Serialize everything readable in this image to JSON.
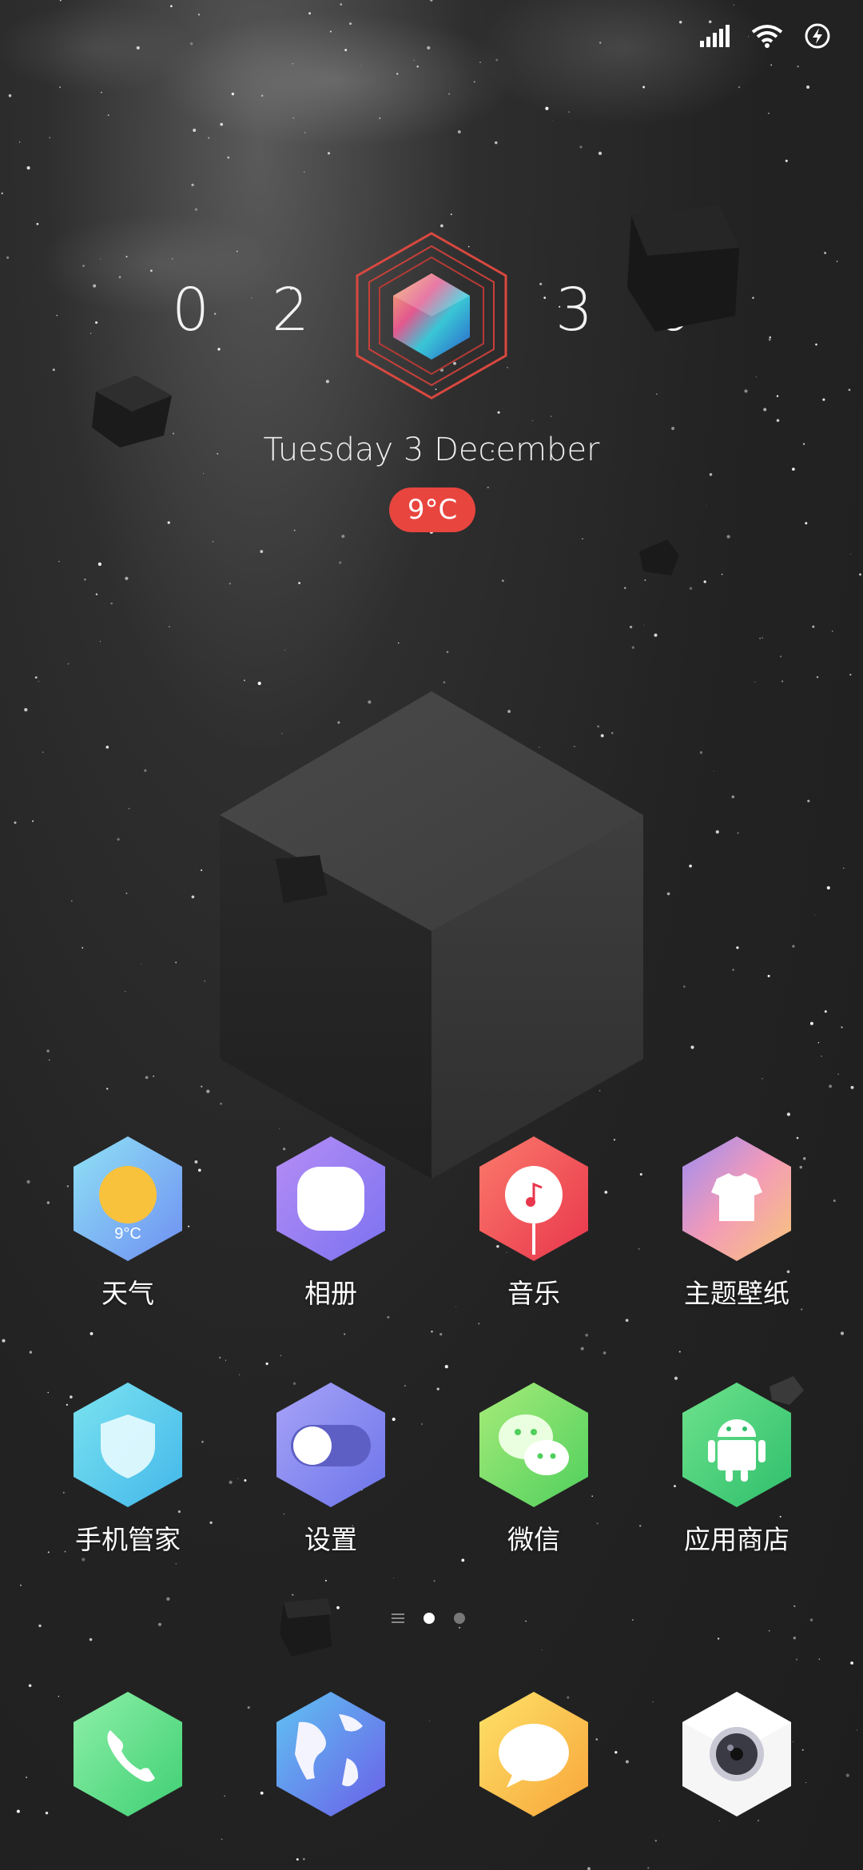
{
  "status_bar": {
    "icons": [
      "signal-icon",
      "wifi-icon",
      "battery-charging-icon"
    ]
  },
  "clock": {
    "hour_tens": "0",
    "hour_ones": "2",
    "minute_tens": "3",
    "minute_ones": "6",
    "date": "Tuesday 3 December",
    "temperature": "9°C"
  },
  "apps": [
    {
      "label": "天气",
      "icon": "weather-icon",
      "badge": "9°C"
    },
    {
      "label": "相册",
      "icon": "gallery-icon"
    },
    {
      "label": "音乐",
      "icon": "music-icon"
    },
    {
      "label": "主题壁纸",
      "icon": "theme-icon"
    },
    {
      "label": "手机管家",
      "icon": "security-shield-icon"
    },
    {
      "label": "设置",
      "icon": "settings-toggle-icon"
    },
    {
      "label": "微信",
      "icon": "wechat-icon"
    },
    {
      "label": "应用商店",
      "icon": "app-store-icon"
    }
  ],
  "page_indicator": {
    "pages": 2,
    "active": 1
  },
  "dock": [
    {
      "icon": "phone-icon"
    },
    {
      "icon": "browser-globe-icon"
    },
    {
      "icon": "messages-icon"
    },
    {
      "icon": "camera-icon"
    }
  ],
  "colors": {
    "accent_red": "#e8453f",
    "background": "#222222"
  }
}
